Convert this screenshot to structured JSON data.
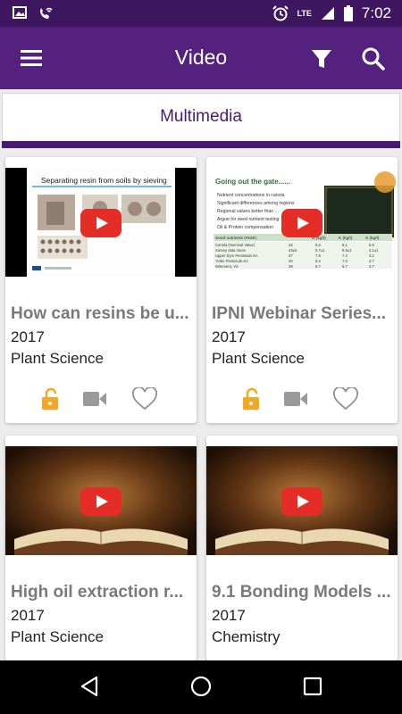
{
  "status_bar": {
    "time": "7:02",
    "network": "LTE",
    "icons": [
      "image-icon",
      "phone-wifi-icon",
      "alarm-icon",
      "lte-signal-icon",
      "signal-icon",
      "battery-icon"
    ]
  },
  "app_bar": {
    "title": "Video",
    "icons": [
      "menu-icon",
      "filter-icon",
      "search-icon"
    ]
  },
  "tabs": {
    "active": "Multimedia"
  },
  "cards": [
    {
      "title": "How can resins be u...",
      "year": "2017",
      "category": "Plant Science",
      "thumb_heading": "Separating resin from soils by sieving"
    },
    {
      "title": "IPNI Webinar Series...",
      "year": "2017",
      "category": "Plant Science",
      "thumb_heading": "Going out the gate......",
      "thumb_bullets": [
        "Nutrient concentrations in canola",
        "Significant differences among regions",
        "Regional values better than ...",
        "Argue for seed nutrient testing",
        "Oil & Protein compensation"
      ],
      "thumb_table_headers": [
        "Seed nutrients 0%MC",
        "N (kg/t)",
        "K (kg/t)",
        "S (kg/t)"
      ],
      "thumb_table_rows": [
        [
          "Canola (Nominal Value)",
          "34",
          "5.6",
          "8.1",
          "5.5"
        ],
        [
          "Survey data mean",
          "43±6",
          "5.7±1",
          "6.9±1",
          "4.1±1"
        ],
        [
          "Upper Eyre Peninsula SA",
          "37",
          "7.8",
          "7.4",
          "3.2"
        ],
        [
          "Yorke Peninsula SA",
          "40",
          "6.2",
          "7.3",
          "3.7"
        ],
        [
          "Wimmera, Vic",
          "39",
          "5.7",
          "6.7",
          "3.7"
        ]
      ]
    },
    {
      "title": "High oil extraction r...",
      "year": "2017",
      "category": "Plant Science"
    },
    {
      "title": "9.1 Bonding Models ...",
      "year": "2017",
      "category": "Chemistry"
    }
  ],
  "card_actions": [
    "unlock-icon",
    "video-camera-icon",
    "heart-icon"
  ],
  "nav_bar": {
    "icons": [
      "back-icon",
      "home-icon",
      "recents-icon"
    ]
  },
  "colors": {
    "status_bar": "#3f1660",
    "app_bar": "#55217f",
    "tab_accent": "#4a1a73",
    "play_button": "#e52d27",
    "unlock": "#f5a623"
  }
}
